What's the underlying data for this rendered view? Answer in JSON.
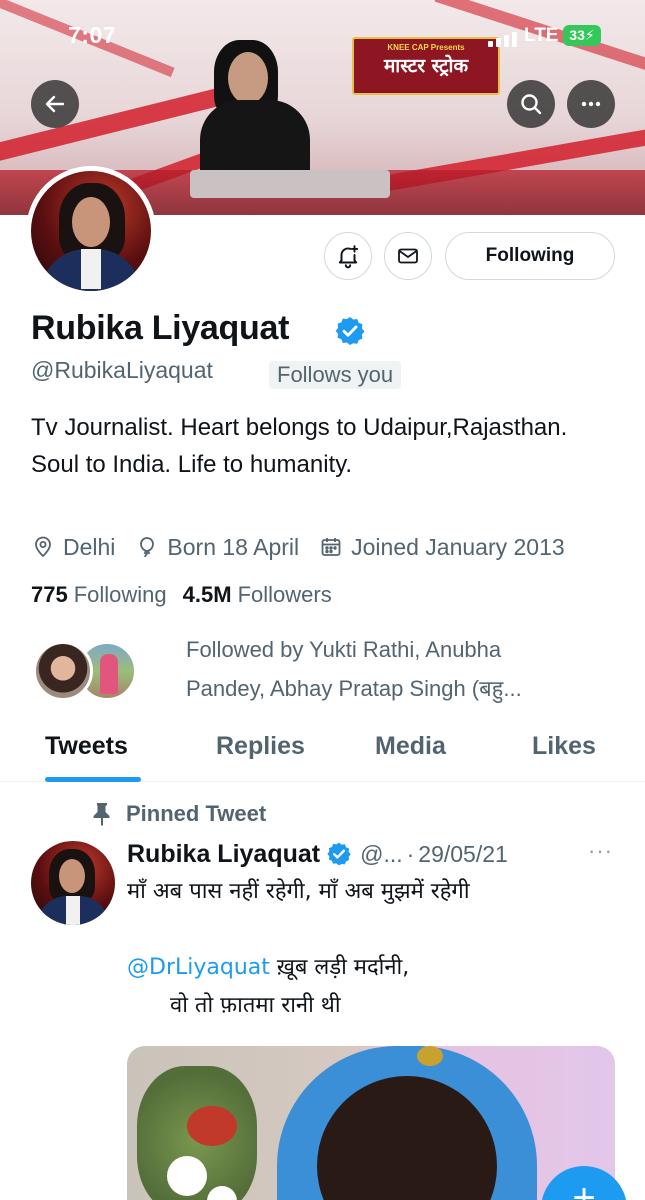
{
  "status_bar": {
    "time": "7:07",
    "network": "LTE",
    "battery": "33"
  },
  "banner": {
    "show_brand": "KNEE CAP Presents",
    "show_title": "मास्टर स्ट्रोक"
  },
  "icons": {
    "back": "arrow-left-icon",
    "search": "search-icon",
    "more": "more-horizontal-icon",
    "notify": "bell-plus-icon",
    "message": "envelope-icon",
    "verified": "verified-badge-icon",
    "location": "location-pin-icon",
    "birthday": "balloon-icon",
    "joined": "calendar-icon",
    "pin": "pin-icon",
    "compose": "plus-icon"
  },
  "colors": {
    "accent": "#1d9bf0",
    "secondary_text": "#536471",
    "battery": "#34c759"
  },
  "profile": {
    "display_name": "Rubika Liyaquat",
    "handle": "@RubikaLiyaquat",
    "follows_you": "Follows you",
    "following_button": "Following",
    "bio": "Tv Journalist. Heart belongs to Udaipur,Rajasthan. Soul to India. Life to humanity.",
    "location": "Delhi",
    "birthday": "Born 18 April",
    "joined": "Joined January 2013",
    "following_count": "775",
    "following_label": "Following",
    "followers_count": "4.5M",
    "followers_label": "Followers",
    "followed_by": "Followed by Yukti Rathi, Anubha Pandey, Abhay Pratap Singh (बहु..."
  },
  "tabs": [
    {
      "label": "Tweets",
      "active": true
    },
    {
      "label": "Replies",
      "active": false
    },
    {
      "label": "Media",
      "active": false
    },
    {
      "label": "Likes",
      "active": false
    }
  ],
  "pinned_tweet": {
    "pinned_label": "Pinned Tweet",
    "author_name": "Rubika Liyaquat",
    "author_handle": "@...",
    "separator": "·",
    "date": "29/05/21",
    "more": "···",
    "line1": "माँ अब पास नहीं रहेगी, माँ अब मुझमें रहेगी",
    "mention": "@DrLiyaquat",
    "line2_rest": " ख़ूब लड़ी मर्दानी,",
    "line3": "वो तो फ़ातमा रानी थी"
  }
}
